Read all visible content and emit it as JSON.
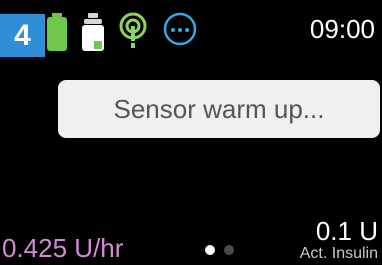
{
  "status_bar": {
    "step_number": "4",
    "time": "09:00",
    "icons": {
      "battery": "battery-full-icon",
      "reservoir": "insulin-reservoir-icon",
      "sensor": "sensor-signal-icon",
      "more": "more-options-icon"
    },
    "colors": {
      "badge": "#2f8ed6",
      "battery": "#6fc84b",
      "sensor": "#8dd45f",
      "more": "#35a7e3"
    }
  },
  "message": {
    "text": "Sensor warm up..."
  },
  "footer": {
    "basal_rate": "0.425 U/hr",
    "active_insulin_value": "0.1 U",
    "active_insulin_label": "Act. Insulin",
    "page_indicator": {
      "total": 2,
      "current": 1
    },
    "colors": {
      "basal_rate": "#d58ad3"
    }
  }
}
